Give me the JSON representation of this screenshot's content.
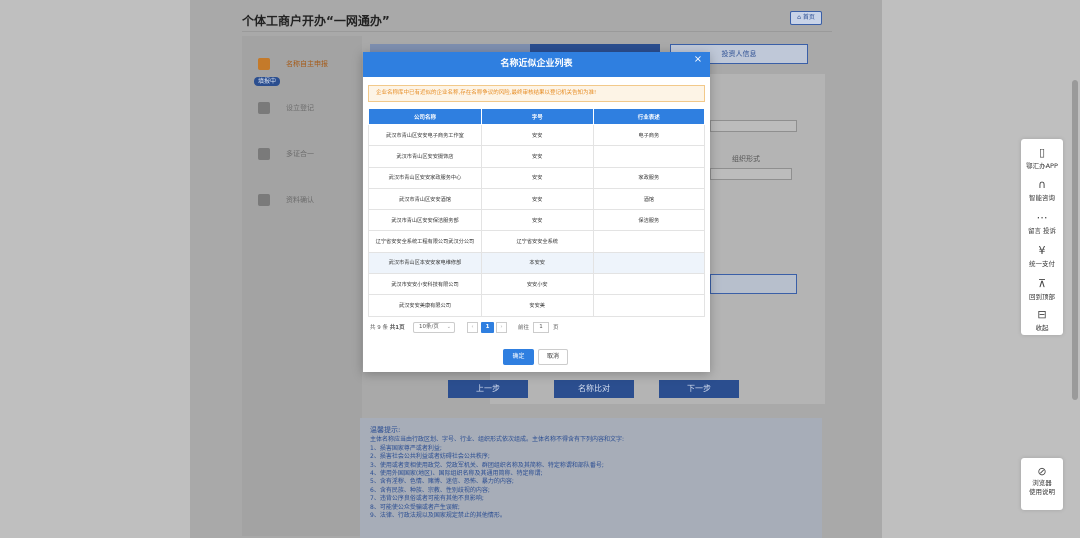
{
  "page": {
    "title": "个体工商户开办“一网通办”",
    "home_label": "首页"
  },
  "steps": [
    {
      "label": "名称自主申报",
      "active": true
    },
    {
      "label": "设立登记",
      "active": false
    },
    {
      "label": "多证合一",
      "active": false
    },
    {
      "label": "资料确认",
      "active": false
    }
  ],
  "step_badge": "填报中",
  "progress": {
    "last_step_label": "投资人信息"
  },
  "form": {
    "org_form_label": "组织形式"
  },
  "actions": {
    "prev": "上一步",
    "compare": "名称比对",
    "next": "下一步"
  },
  "tips": {
    "title": "温馨提示:",
    "lines": [
      "主体名称应当由行政区划、字号、行业、组织形式依次组成。主体名称不得含有下列内容和文字:",
      "1、损害国家尊严或者利益;",
      "2、损害社会公共利益或者妨碍社会公共秩序;",
      "3、使用或者变相使用政党、党政军机关、群团组织名称及其简称、特定称谓和部队番号;",
      "4、使用外国国家(地区)、国际组织名称及其通用简称、特定称谓;",
      "5、含有淫秽、色情、赌博、迷信、恐怖、暴力的内容;",
      "6、含有民族、种族、宗教、性别歧视的内容;",
      "7、违背公序良俗或者可能有其他不良影响;",
      "8、可能使公众受骗或者产生误解;",
      "9、法律、行政法规以及国家规定禁止的其他情形。"
    ]
  },
  "floatbar": {
    "items": [
      {
        "icon": "▯",
        "label": "鄂汇办APP"
      },
      {
        "icon": "∩",
        "label": "智能咨询"
      },
      {
        "icon": "⋯",
        "label": "留言 投诉"
      },
      {
        "icon": "¥",
        "label": "统一支付"
      },
      {
        "icon": "⊼",
        "label": "回到顶部"
      },
      {
        "icon": "⊟",
        "label": "收起"
      }
    ],
    "browser_label_1": "浏览器",
    "browser_label_2": "使用说明"
  },
  "modal": {
    "title": "名称近似企业列表",
    "close": "×",
    "warning": "企业名称库中已有近似的企业名称,存在名称争议的风险,最终审核结果以登记机关告知为准!",
    "columns": [
      "公司名称",
      "字号",
      "行业表述"
    ],
    "rows": [
      [
        "武汉市青山区安安电子商务工作室",
        "安安",
        "电子商务"
      ],
      [
        "武汉市青山区安安摄饰店",
        "安安",
        ""
      ],
      [
        "武汉市青山区安安家政服务中心",
        "安安",
        "家政服务"
      ],
      [
        "武汉市青山区安安酒馆",
        "安安",
        "酒馆"
      ],
      [
        "武汉市青山区安安保洁服务部",
        "安安",
        "保洁服务"
      ],
      [
        "辽宁省安安全系统工程有限公司武汉分公司",
        "辽宁省安安全系统",
        ""
      ],
      [
        "武汉市青山区本安安家电维修部",
        "本安安",
        ""
      ],
      [
        "武汉市安安小安科技有限公司",
        "安安小安",
        ""
      ],
      [
        "武汉安安美康有限公司",
        "安安美",
        ""
      ]
    ],
    "highlight_row": 6,
    "pager": {
      "total": "共 9 条",
      "pages": "共1页",
      "page_size": "10条/页",
      "current": "1",
      "goto_label": "前往",
      "goto_value": "1",
      "unit": "页"
    },
    "ok_label": "确定",
    "cancel_label": "取消"
  },
  "colors": {
    "primary": "#2f7fe0",
    "warning_text": "#e68a1f",
    "overlay_blue": "#2b4e8f"
  }
}
